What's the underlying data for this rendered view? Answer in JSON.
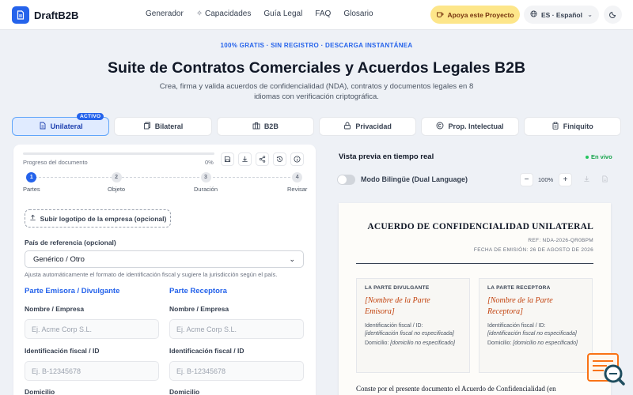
{
  "brand": {
    "name": "DraftB2B"
  },
  "nav": [
    "Generador",
    "Capacidades",
    "Guía Legal",
    "FAQ",
    "Glosario"
  ],
  "header": {
    "support_label": "Apoya este Proyecto",
    "language_label": "ES · Español"
  },
  "hero": {
    "tag": "100% GRATIS · SIN REGISTRO · DESCARGA INSTANTÁNEA",
    "title": "Suite de Contratos Comerciales y Acuerdos Legales B2B",
    "subtitle": "Crea, firma y valida acuerdos de confidencialidad (NDA), contratos y documentos legales en 8 idiomas con verificación criptográfica."
  },
  "tabs": [
    {
      "label": "Unilateral",
      "icon": "document-icon",
      "active": true,
      "badge": "ACTIVO"
    },
    {
      "label": "Bilateral",
      "icon": "copy-icon"
    },
    {
      "label": "B2B",
      "icon": "building-icon"
    },
    {
      "label": "Privacidad",
      "icon": "lock-icon"
    },
    {
      "label": "Prop. Intelectual",
      "icon": "copyright-icon"
    },
    {
      "label": "Finiquito",
      "icon": "clipboard-icon"
    }
  ],
  "form": {
    "progress_label": "Progreso del documento",
    "progress_value": "0%",
    "progress_fraction": 0,
    "steps": [
      {
        "number": "1",
        "label": "Partes",
        "active": true
      },
      {
        "number": "2",
        "label": "Objeto"
      },
      {
        "number": "3",
        "label": "Duración"
      },
      {
        "number": "4",
        "label": "Revisar"
      }
    ],
    "upload_label": "Subir logotipo de la empresa (opcional)",
    "country_label": "País de referencia (opcional)",
    "country_value": "Genérico / Otro",
    "country_hint": "Ajusta automáticamente el formato de identificación fiscal y sugiere la jurisdicción según el país.",
    "emitter": {
      "title": "Parte Emisora / Divulgante",
      "name_label": "Nombre / Empresa",
      "name_placeholder": "Ej. Acme Corp S.L.",
      "tax_label": "Identificación fiscal / ID",
      "tax_placeholder": "Ej. B-12345678",
      "address_label": "Domicilio"
    },
    "receiver": {
      "title": "Parte Receptora",
      "name_label": "Nombre / Empresa",
      "name_placeholder": "Ej. Acme Corp S.L.",
      "tax_label": "Identificación fiscal / ID",
      "tax_placeholder": "Ej. B-12345678",
      "address_label": "Domicilio"
    }
  },
  "preview": {
    "title": "Vista previa en tiempo real",
    "live": "En vivo",
    "bilingual_label": "Modo Bilingüe (Dual Language)",
    "zoom": "100%",
    "doc": {
      "title": "ACUERDO DE CONFIDENCIALIDAD UNILATERAL",
      "ref": "REF: NDA-2026-QR0BPM",
      "date": "FECHA DE EMISIÓN: 26 DE AGOSTO DE 2026",
      "party_a": {
        "heading": "LA PARTE DIVULGANTE",
        "name": "[Nombre de la Parte Emisora]",
        "tax_label": "Identificación fiscal / ID:",
        "tax_value": "[identificación fiscal no especificada]",
        "address_label": "Domicilio:",
        "address_value": "[domicilio no especificado]"
      },
      "party_b": {
        "heading": "LA PARTE RECEPTORA",
        "name": "[Nombre de la Parte Receptora]",
        "tax_label": "Identificación fiscal / ID:",
        "tax_value": "[identificación fiscal no especificada]",
        "address_label": "Domicilio:",
        "address_value": "[domicilio no especificado]"
      },
      "body": "Conste por el presente documento el Acuerdo de Confidencialidad (en"
    }
  },
  "colors": {
    "accent": "#2563eb",
    "support": "#fde68a",
    "party_name": "#c2410c",
    "live": "#16a34a"
  }
}
